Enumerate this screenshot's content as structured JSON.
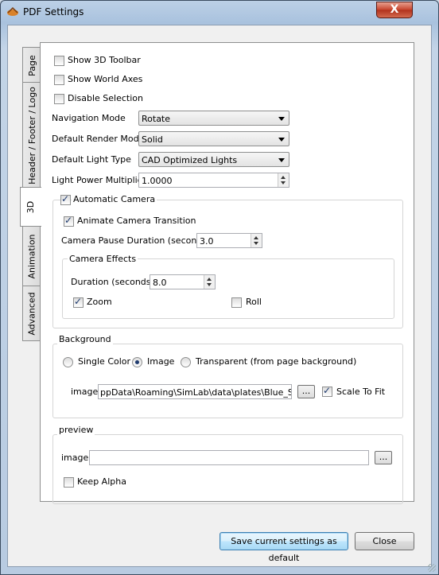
{
  "window": {
    "title": "PDF Settings",
    "close_symbol": "X"
  },
  "tabs": [
    "Page",
    "Header / Footer / Logo",
    "3D",
    "Animation",
    "Advanced"
  ],
  "options": {
    "show_3d_toolbar": {
      "label": "Show 3D Toolbar",
      "checked": false
    },
    "show_world_axes": {
      "label": "Show World Axes",
      "checked": false
    },
    "disable_selection": {
      "label": "Disable Selection",
      "checked": false
    }
  },
  "navigation_mode": {
    "label": "Navigation Mode",
    "value": "Rotate"
  },
  "render_mode": {
    "label": "Default Render Mode",
    "value": "Solid"
  },
  "light_type": {
    "label": "Default Light Type",
    "value": "CAD Optimized Lights"
  },
  "light_power": {
    "label": "Light Power Multiplier",
    "value": "1.0000"
  },
  "camera": {
    "title": "Automatic Camera",
    "animate_transition": "Animate Camera Transition",
    "pause_label": "Camera Pause Duration (seconds)",
    "pause_value": "3.0",
    "effects": {
      "title": "Camera Effects",
      "duration_label": "Duration (seconds)",
      "duration_value": "8.0",
      "zoom_label": "Zoom",
      "roll_label": "Roll"
    }
  },
  "background": {
    "title": "Background",
    "single_color": "Single Color",
    "image": "Image",
    "transparent": "Transparent (from page background)",
    "image_label": "image",
    "image_path": "ppData\\Roaming\\SimLab\\data\\plates\\Blue_Sky.jpg",
    "browse": "...",
    "scale_to_fit": "Scale To Fit"
  },
  "preview": {
    "title": "preview",
    "image_label": "image",
    "image_path": "",
    "browse": "...",
    "keep_alpha": "Keep Alpha"
  },
  "buttons": {
    "save_default": "Save current settings as default",
    "close": "Close"
  }
}
